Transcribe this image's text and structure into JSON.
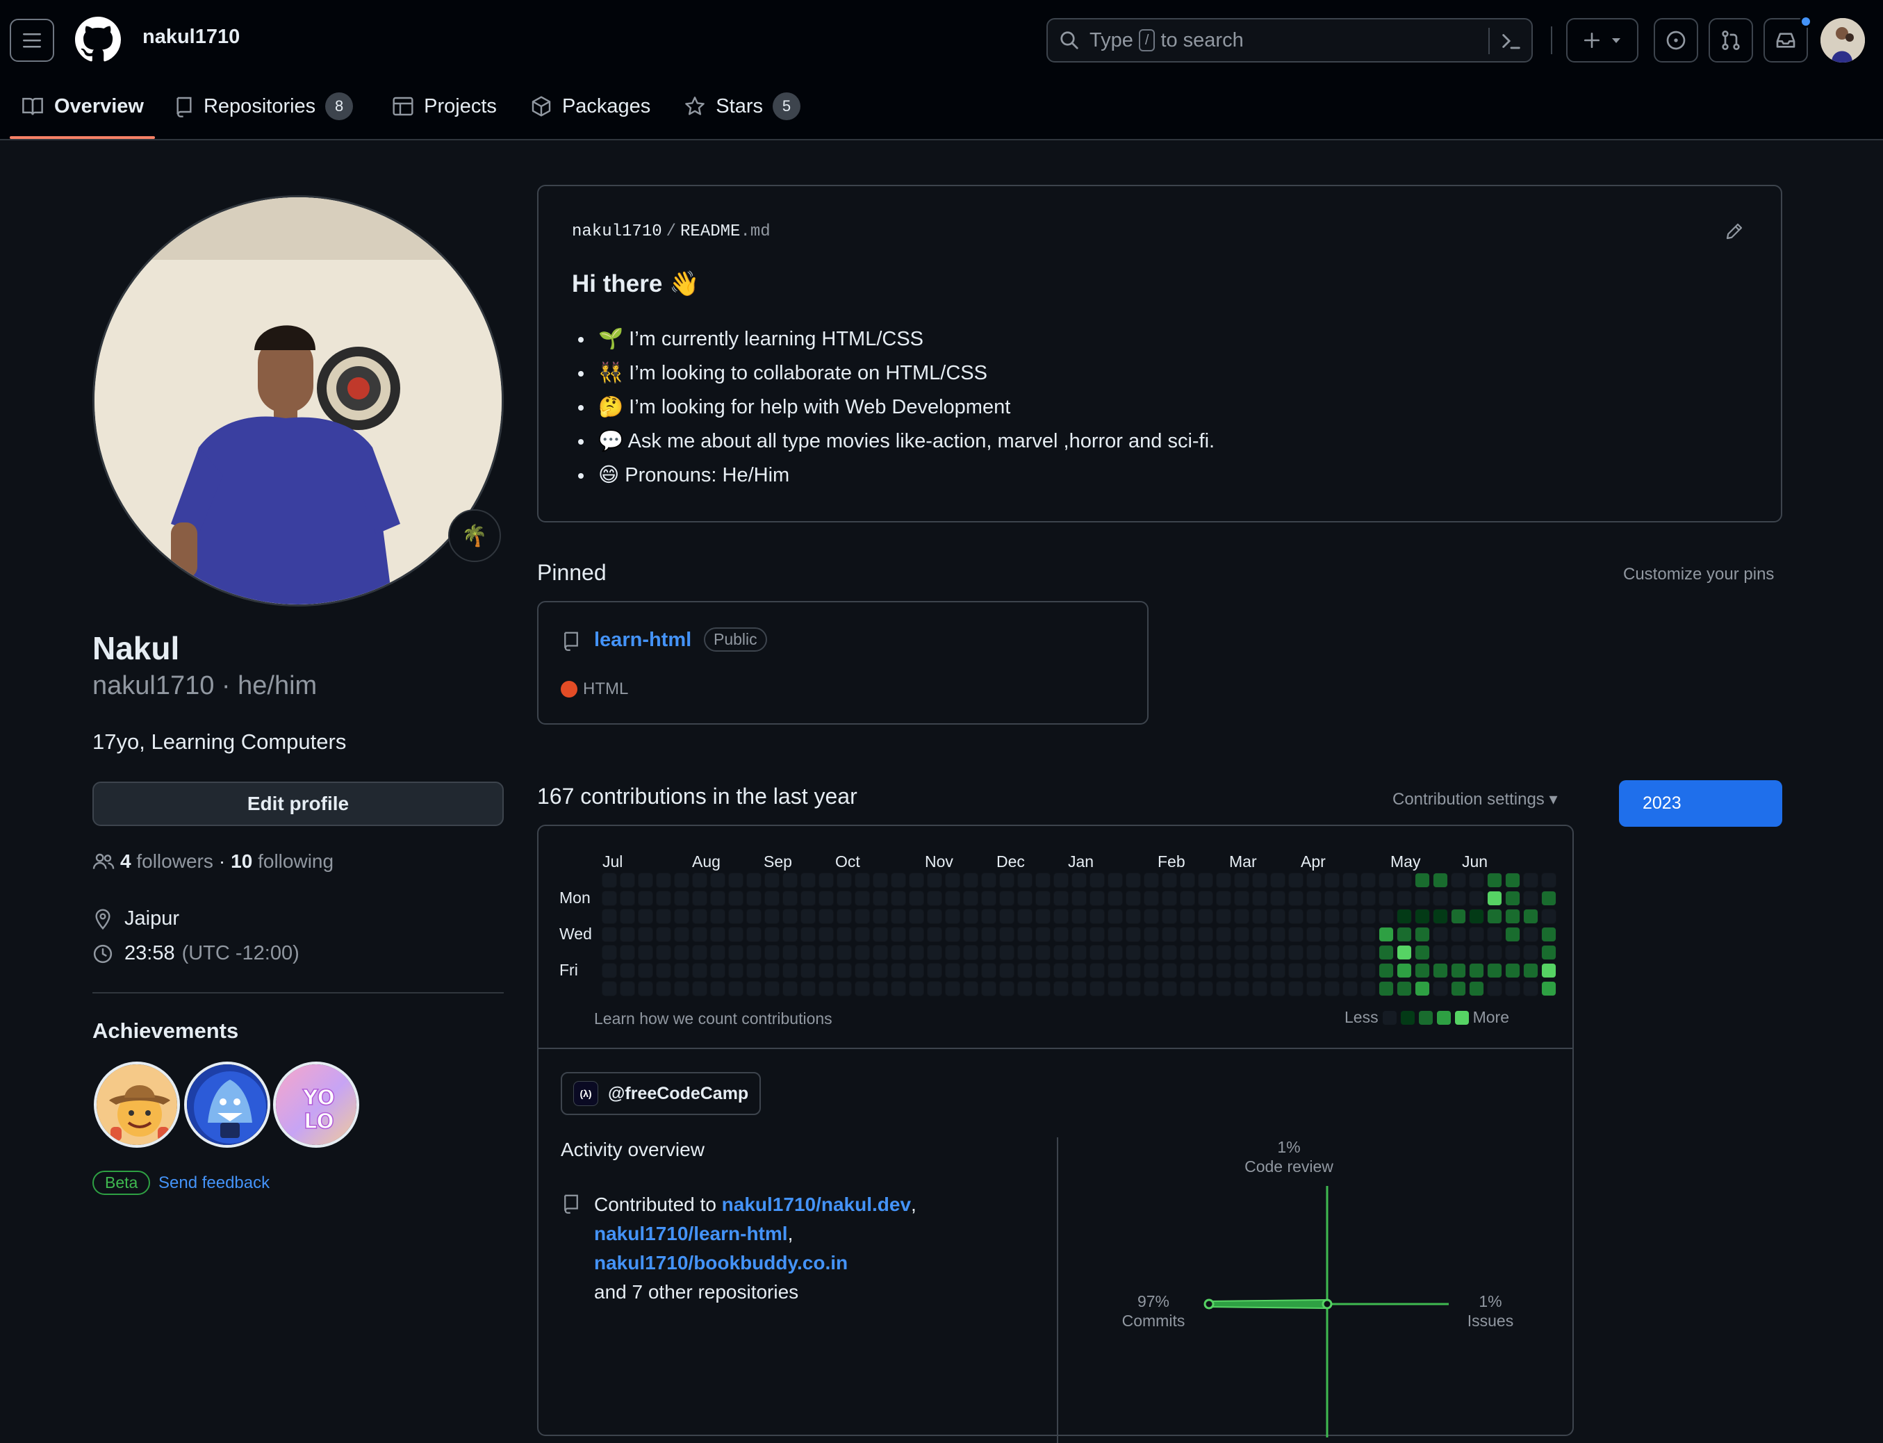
{
  "header": {
    "username": "nakul1710",
    "search_prefix": "Type",
    "search_key": "/",
    "search_suffix": "to search"
  },
  "tabs": [
    {
      "label": "Overview",
      "icon": "book-icon"
    },
    {
      "label": "Repositories",
      "count": "8",
      "icon": "repo-icon"
    },
    {
      "label": "Projects",
      "icon": "table-icon"
    },
    {
      "label": "Packages",
      "icon": "package-icon"
    },
    {
      "label": "Stars",
      "count": "5",
      "icon": "star-icon"
    }
  ],
  "profile": {
    "name": "Nakul",
    "login_line": "nakul1710 · he/him",
    "bio": "17yo, Learning Computers",
    "edit_label": "Edit profile",
    "followers_count": "4",
    "followers_label": "followers",
    "dot": "·",
    "following_count": "10",
    "following_label": "following",
    "location": "Jaipur",
    "time": "23:58",
    "tz": "(UTC -12:00)",
    "status_emoji": "🌴"
  },
  "achievements": {
    "title": "Achievements",
    "beta": "Beta",
    "feedback": "Send feedback"
  },
  "readme": {
    "owner": "nakul1710",
    "sep": "/",
    "file": "README",
    "ext": ".md",
    "heading": "Hi there 👋",
    "items": [
      "🌱 I’m currently learning HTML/CSS",
      "👯 I’m looking to collaborate on HTML/CSS",
      "🤔 I’m looking for help with Web Development",
      "💬 Ask me about all type movies like-action, marvel ,horror and sci-fi.",
      "😄 Pronouns: He/Him"
    ]
  },
  "pinned": {
    "title": "Pinned",
    "customize": "Customize your pins",
    "repo_name": "learn-html",
    "visibility": "Public",
    "language": "HTML",
    "language_color": "#e34c26"
  },
  "contributions": {
    "title": "167 contributions in the last year",
    "settings": "Contribution settings ▾",
    "year": "2023",
    "months": [
      "Jul",
      "Aug",
      "Sep",
      "Oct",
      "Nov",
      "Dec",
      "Jan",
      "Feb",
      "Mar",
      "Apr",
      "May",
      "Jun"
    ],
    "days": [
      "Mon",
      "Wed",
      "Fri"
    ],
    "learn": "Learn how we count contributions",
    "less": "Less",
    "more": "More",
    "colors": [
      "#151b23",
      "#033a16",
      "#196c2e",
      "#2ea043",
      "#56d364"
    ]
  },
  "activity": {
    "org": "@freeCodeCamp",
    "title": "Activity overview",
    "prefix": "Contributed to",
    "repo1": "nakul1710/nakul.dev",
    "comma": ",",
    "repo2": "nakul1710/learn-html",
    "repo3": "nakul1710/bookbuddy.co.in",
    "rest": "and 7 other repositories",
    "code_review_pct": "1%",
    "code_review": "Code review",
    "commits_pct": "97%",
    "commits": "Commits",
    "issues_pct": "1%",
    "issues": "Issues"
  }
}
